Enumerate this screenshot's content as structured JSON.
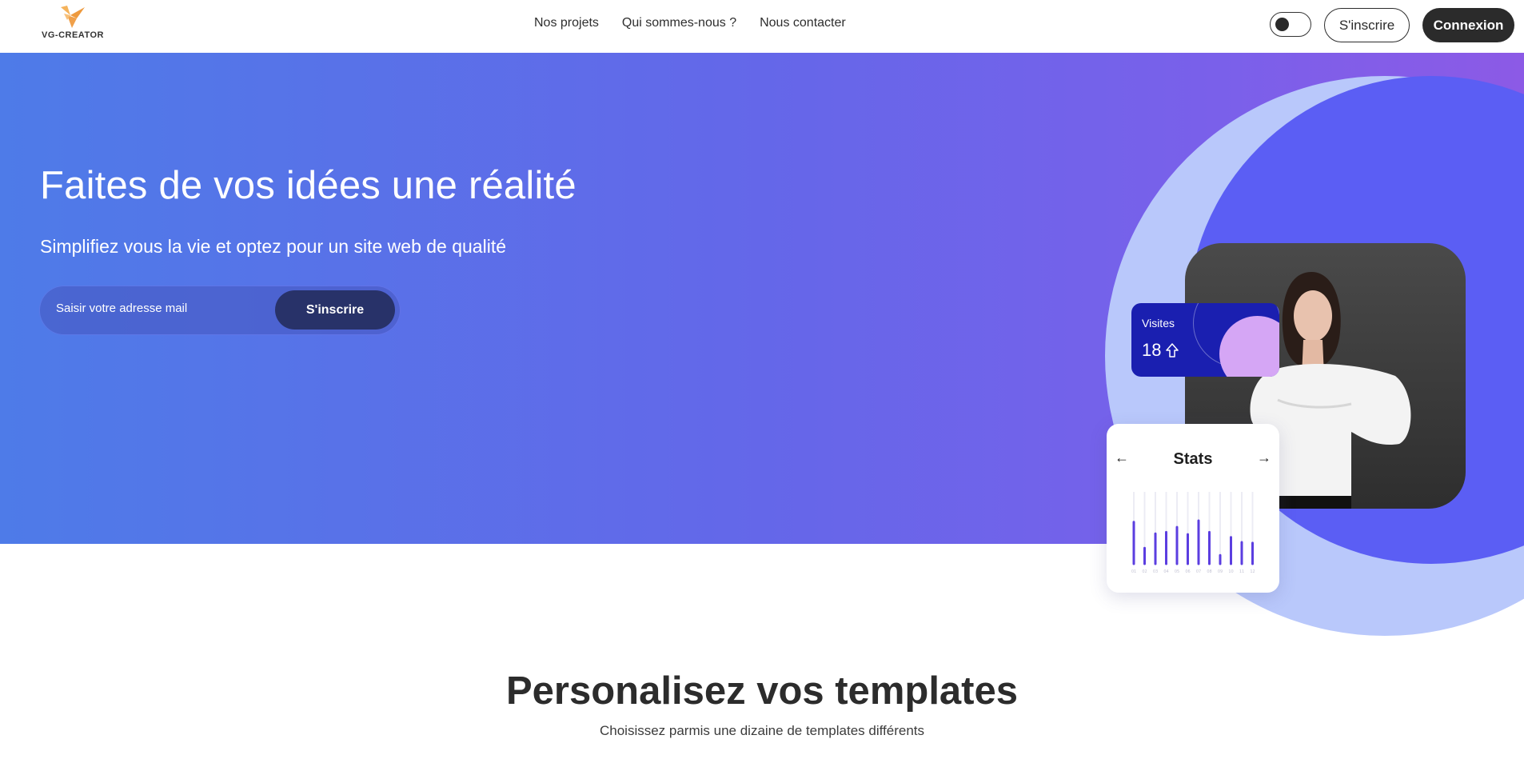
{
  "header": {
    "logo_text": "VG-CREATOR",
    "nav": [
      "Nos projets",
      "Qui sommes-nous ?",
      "Nous contacter"
    ],
    "signup_label": "S'inscrire",
    "login_label": "Connexion"
  },
  "hero": {
    "title": "Faites de vos idées une réalité",
    "subtitle": "Simplifiez vous la vie et optez pour un site web de qualité",
    "email_placeholder": "Saisir votre adresse mail",
    "signup_button": "S'inscrire"
  },
  "visits_card": {
    "label": "Visites",
    "value": "18"
  },
  "stats_card": {
    "title": "Stats",
    "prev_arrow": "←",
    "next_arrow": "→",
    "bars": [
      0.58,
      0.22,
      0.42,
      0.44,
      0.51,
      0.41,
      0.6,
      0.44,
      0.12,
      0.37,
      0.3,
      0.29
    ],
    "tick_labels": [
      "01",
      "02",
      "03",
      "04",
      "05",
      "06",
      "07",
      "08",
      "09",
      "10",
      "11",
      "12"
    ]
  },
  "section": {
    "title": "Personalisez vos templates",
    "subtitle": "Choisissez parmis une dizaine de templates différents"
  },
  "colors": {
    "hero_start": "#4e7be8",
    "hero_end": "#8c5ae6",
    "dark": "#2b2b2b",
    "accent_blue": "#1a1fb0",
    "bar_color": "#5b3ee0",
    "logo_orange": "#f0a04a"
  }
}
